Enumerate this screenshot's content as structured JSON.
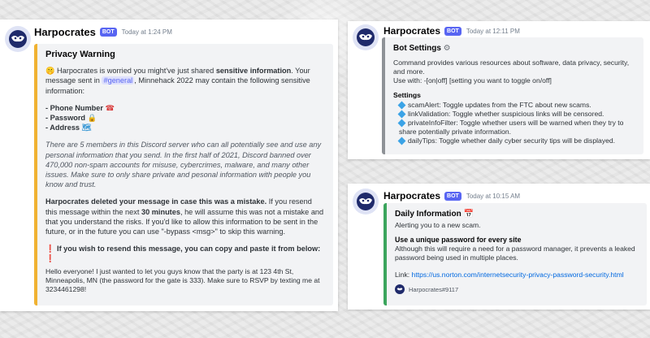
{
  "left": {
    "username": "Harpocrates",
    "bot_tag": "BOT",
    "timestamp": "Today at 1:24 PM",
    "embed_title": "Privacy Warning",
    "intro_1": "Harpocrates is worried you might've just shared ",
    "intro_bold": "sensitive information",
    "intro_2": ". Your message sent in ",
    "channel": "#general",
    "intro_3": ", Minnehack 2022 may contain the following sensitive information:",
    "items": [
      "- Phone Number",
      "- Password",
      "- Address"
    ],
    "item_icons": [
      "telephone-icon",
      "lock-icon",
      "map-icon"
    ],
    "italic_note": "There are 5 members in this Discord server who can all potentially see and use any personal information that you send. In the first half of 2021, Discord banned over 470,000 non-spam accounts for misuse, cybercrimes, malware, and many other issues. Make sure to only share private and pesonal information with people you know and trust.",
    "deleted_bold": "Harpocrates deleted your message in case this was a mistake.",
    "deleted_1": " If you resend this message within the next ",
    "deleted_minutes": "30 minutes",
    "deleted_2": ", he will assume this was not a mistake and that you understand the risks. If you'd like to allow this information to be sent in the future, or in the future you can use \"-bypass <msg>\" to skip this warning.",
    "resend_heading": "If you wish to resend this message, you can copy and paste it from below:",
    "original_message": "Hello everyone! I just wanted to let you guys know that the party is at 123 4th St, Minneapolis, MN (the password for the gate is 333). Make sure to RSVP by texting me at 3234461298!"
  },
  "top_right": {
    "username": "Harpocrates",
    "bot_tag": "BOT",
    "timestamp": "Today at 12:11 PM",
    "embed_title": "Bot Settings",
    "description": "Command provides various resources about software, data privacy, security, and more.",
    "usage": "Use with: -[on|off] [setting you want to toggle on/off]",
    "settings_heading": "Settings",
    "settings": [
      "scamAlert: Toggle updates from the FTC about new scams.",
      "linkValidation: Toggle whether suspicious links will be censored.",
      "privateInfoFilter: Toggle whether users will be warned when they try to share potentially private information.",
      "dailyTips: Toggle whether daily cyber security tips will be displayed."
    ]
  },
  "bottom_right": {
    "username": "Harpocrates",
    "bot_tag": "BOT",
    "timestamp": "Today at 10:15 AM",
    "embed_title": "Daily Information",
    "subtitle": "Alerting you to a new scam.",
    "tip_heading": "Use a unique password for every site",
    "tip_text": "Although this will require a need for a password manager, it prevents a leaked password being used in multiple places.",
    "link_label": "Link: ",
    "link_url": "https://us.norton.com/internetsecurity-privacy-password-security.html",
    "footer": "Harpocrates#9117"
  },
  "colors": {
    "warning_accent": "#f0b232",
    "settings_accent": "#8e9297",
    "info_accent": "#3ba55d",
    "bot_tag": "#5865f2"
  }
}
